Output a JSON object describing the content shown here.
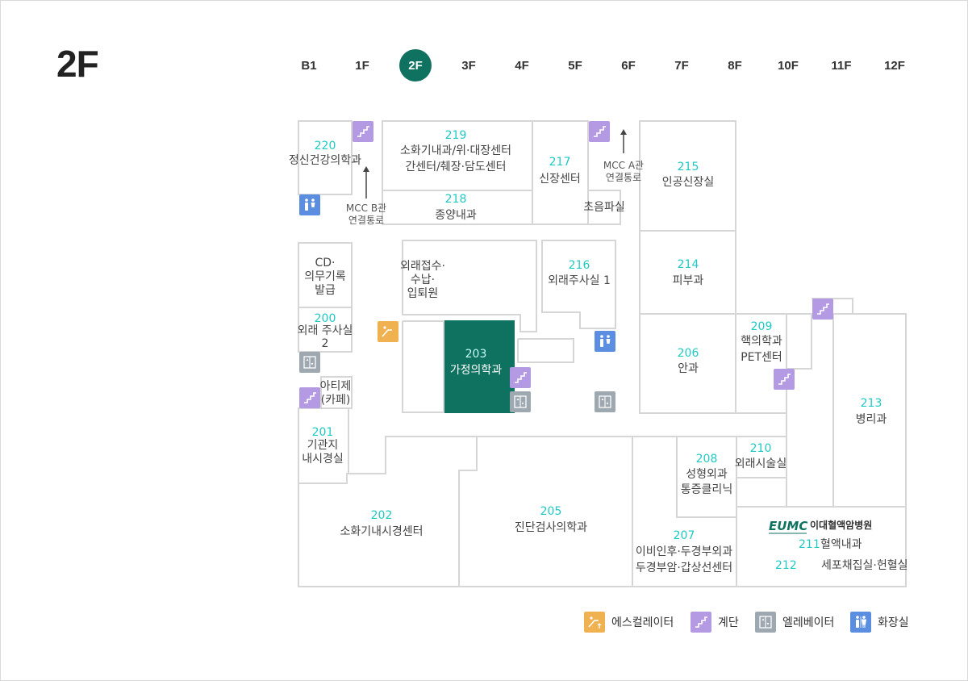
{
  "floor_title": "2F",
  "floors": [
    "B1",
    "1F",
    "2F",
    "3F",
    "4F",
    "5F",
    "6F",
    "7F",
    "8F",
    "10F",
    "11F",
    "12F"
  ],
  "active_floor": "2F",
  "colors": {
    "primary": "#0f7260",
    "number": "#1fc9c4",
    "wall": "#d6d6d6",
    "stairs": "#b49ae3",
    "escalator": "#f0b251",
    "elevator": "#9ea8b0",
    "restroom": "#5b8ee0"
  },
  "rooms": [
    {
      "id": "r220",
      "number": "220",
      "name": "정신건강의학과",
      "highlight": false
    },
    {
      "id": "r219",
      "number": "219",
      "name": "소화기내과/위·대장센터 간센터/췌장·담도센터",
      "highlight": false
    },
    {
      "id": "r218",
      "number": "218",
      "name": "종양내과",
      "highlight": false
    },
    {
      "id": "r217",
      "number": "217",
      "name": "신장센터",
      "highlight": false
    },
    {
      "id": "rUS",
      "number": "",
      "name": "초음파실",
      "highlight": false
    },
    {
      "id": "r215",
      "number": "215",
      "name": "인공신장실",
      "highlight": false
    },
    {
      "id": "rCD",
      "number": "",
      "name": "CD· 의무기록 발급",
      "highlight": false
    },
    {
      "id": "rRecep",
      "number": "",
      "name": "외래접수· 수납· 입퇴원",
      "highlight": false
    },
    {
      "id": "r216",
      "number": "216",
      "name": "외래주사실 1",
      "highlight": false
    },
    {
      "id": "r214",
      "number": "214",
      "name": "피부과",
      "highlight": false
    },
    {
      "id": "r200",
      "number": "200",
      "name": "외래 주사실 2",
      "highlight": false
    },
    {
      "id": "r203",
      "number": "203",
      "name": "가정의학과",
      "highlight": true
    },
    {
      "id": "r206",
      "number": "206",
      "name": "안과",
      "highlight": false
    },
    {
      "id": "r209",
      "number": "209",
      "name": "핵의학과 PET센터",
      "highlight": false
    },
    {
      "id": "rCafe",
      "number": "",
      "name": "아티제 (카페)",
      "highlight": false
    },
    {
      "id": "r201",
      "number": "201",
      "name": "기관지 내시경실",
      "highlight": false
    },
    {
      "id": "r213",
      "number": "213",
      "name": "병리과",
      "highlight": false
    },
    {
      "id": "r208",
      "number": "208",
      "name": "성형외과 통증클리닉",
      "highlight": false
    },
    {
      "id": "r210",
      "number": "210",
      "name": "외래시술실",
      "highlight": false
    },
    {
      "id": "r202",
      "number": "202",
      "name": "소화기내시경센터",
      "highlight": false
    },
    {
      "id": "r205",
      "number": "205",
      "name": "진단검사의학과",
      "highlight": false
    },
    {
      "id": "r207",
      "number": "207",
      "name": "이비인후·두경부외과 두경부암·갑상선센터",
      "highlight": false
    },
    {
      "id": "r211",
      "number": "211",
      "name": "혈액내과",
      "highlight": false
    },
    {
      "id": "r212",
      "number": "212",
      "name": "세포채집실·헌혈실",
      "highlight": false
    }
  ],
  "passages": {
    "b": "MCC B관 연결통로",
    "a": "MCC A관 연결통로"
  },
  "eumc_logo": {
    "mark": "EUMC",
    "text": "이대혈액암병원"
  },
  "legend": {
    "escalator": "에스컬레이터",
    "stairs": "계단",
    "elevator": "엘레베이터",
    "restroom": "화장실"
  }
}
